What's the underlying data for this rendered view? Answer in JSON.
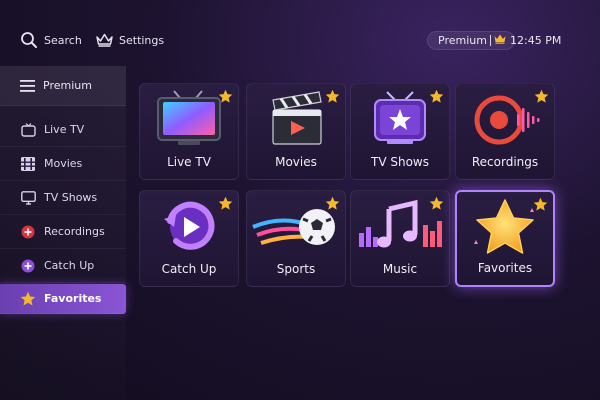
{
  "topbar": {
    "search_label": "Search",
    "settings_label": "Settings",
    "premium_label": "Premium",
    "time": "12:45 PM"
  },
  "sidebar": {
    "header_label": "Premium",
    "items": [
      {
        "label": "Live TV",
        "icon": "tv-outline-icon"
      },
      {
        "label": "Movies",
        "icon": "film-grid-icon"
      },
      {
        "label": "TV Shows",
        "icon": "monitor-icon"
      },
      {
        "label": "Recordings",
        "icon": "record-icon"
      },
      {
        "label": "Catch Up",
        "icon": "plus-circle-icon"
      },
      {
        "label": "Favorites",
        "icon": "star-icon",
        "active": true
      }
    ]
  },
  "tiles": [
    {
      "label": "Live TV",
      "icon": "tv-icon"
    },
    {
      "label": "Movies",
      "icon": "clapperboard-icon"
    },
    {
      "label": "TV Shows",
      "icon": "retro-tv-star-icon"
    },
    {
      "label": "Recordings",
      "icon": "record-soundwave-icon"
    },
    {
      "label": "Catch Up",
      "icon": "replay-icon"
    },
    {
      "label": "Sports",
      "icon": "soccer-ball-icon"
    },
    {
      "label": "Music",
      "icon": "music-note-icon"
    },
    {
      "label": "Favorites",
      "icon": "big-star-icon",
      "selected": true
    }
  ],
  "colors": {
    "accent": "#8a55d6",
    "star": "#f5b82a",
    "background": "#1d1330"
  }
}
